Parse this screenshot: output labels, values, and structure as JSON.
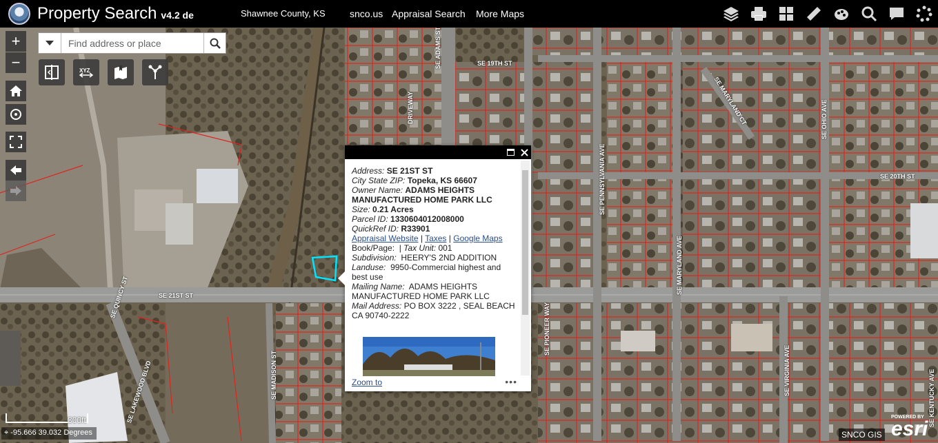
{
  "header": {
    "title": "Property Search",
    "version": "v4.2 de",
    "county": "Shawnee County, KS",
    "links": [
      "snco.us",
      "Appraisal Search",
      "More Maps"
    ],
    "icons": [
      "layers-icon",
      "print-icon",
      "basemap-gallery-icon",
      "measure-icon",
      "draw-icon",
      "query-icon",
      "comment-icon",
      "loading-icon"
    ]
  },
  "search": {
    "placeholder": "Find address or place"
  },
  "tools": {
    "zoom_in": "+",
    "zoom_out": "−",
    "widgets": [
      "swipe-icon",
      "xyz-icon",
      "bookmark-icon",
      "share-icon"
    ]
  },
  "popup": {
    "address_label": "Address:",
    "address": "SE 21ST ST",
    "city_label": "City State ZIP:",
    "city": "Topeka, KS 66607",
    "owner_label": "Owner Name:",
    "owner": "ADAMS HEIGHTS MANUFACTURED HOME PARK LLC",
    "size_label": "Size:",
    "size": "0.21 Acres",
    "parcel_label": "Parcel ID:",
    "parcel": "1330604012008000",
    "quickref_label": "QuickRef ID:",
    "quickref": "R33901",
    "link_appraisal": "Appraisal Website",
    "link_taxes": "Taxes",
    "link_maps": "Google Maps",
    "bookpage_label": "Book/Page:",
    "taxunit_label": "Tax Unit:",
    "taxunit": "001",
    "subdivision_label": "Subdivision:",
    "subdivision": "HEERY'S 2ND ADDITION",
    "landuse_label": "Landuse:",
    "landuse": "9950-Commercial highest and best use",
    "mailing_label": "Mailing Name:",
    "mailing": "ADAMS HEIGHTS MANUFACTURED HOME PARK LLC",
    "mailaddr_label": "Mail Address:",
    "mailaddr": "PO BOX 3222 , SEAL BEACH CA 90740-2222",
    "zoom_to": "Zoom to",
    "more": "•••"
  },
  "map": {
    "scale": "300ft",
    "coords": "-95.666 39.032 Degrees",
    "credit": "SNCO GIS",
    "esri_powered": "POWERED BY",
    "esri": "esri",
    "streets": [
      "SE 19TH ST",
      "SE ADAMS ST",
      "DRIVEWAY",
      "SE MARYLAND CT",
      "SE OHIO AVE",
      "SE 20TH ST",
      "SE PENNSYLVANIA AVE",
      "SE MARYLAND AVE",
      "SE 21ST ST",
      "SE QUINCY ST",
      "SE LAKEWOOD BLVD",
      "SE MADISON ST",
      "SE PIONEER WAY",
      "SE VIRGINIA AVE",
      "SE KENTUCKY AVE"
    ]
  },
  "colors": {
    "header_bg": "#000000",
    "parcel_line": "#e0241e",
    "selected_parcel": "#00e5ff"
  }
}
